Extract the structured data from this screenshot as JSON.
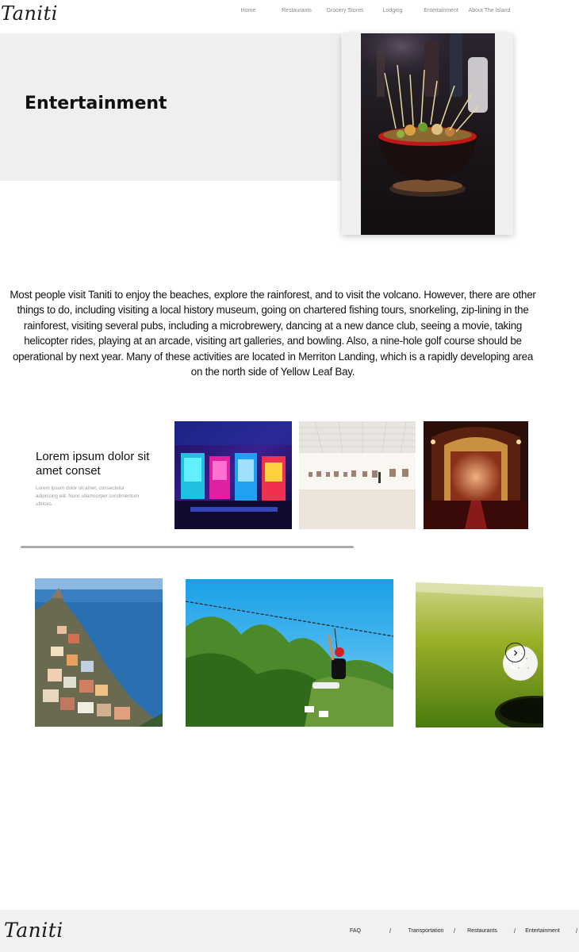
{
  "header": {
    "logo": "Taniti",
    "nav": [
      "Home",
      "Restaurants",
      "Grocery Stores",
      "Lodging",
      "Entertainment",
      "About The Island"
    ]
  },
  "hero": {
    "title": "Entertainment",
    "photo_icon": "food-bowl-skewers-photo"
  },
  "intro": {
    "text": "Most people visit Taniti to enjoy the beaches, explore the rainforest, and to visit the volcano. However, there are other things to do, including visiting a local history museum, going on chartered fishing tours, snorkeling, zip-lining in the rainforest, visiting several pubs, including a microbrewery, dancing at a new dance club, seeing a movie, taking helicopter rides, playing at an arcade, visiting art galleries, and bowling. Also, a nine-hole golf course should be operational by next year. Many of these activities are located in Merriton Landing, which is a rapidly developing area on the north side of Yellow Leaf Bay."
  },
  "feature": {
    "title": "Lorem ipsum dolor sit amet conset",
    "text": "Lorem ipsum dolor sit amet, consectetur adipiscing elit. Nunc ullamcorper condimentum ultrices.",
    "thumbnails": [
      "arcade-photo",
      "art-gallery-photo",
      "theater-photo"
    ]
  },
  "gallery": {
    "images": [
      "coastal-village-photo",
      "zip-line-photo",
      "golf-ball-photo"
    ],
    "next_icon": "chevron-right-icon"
  },
  "footer": {
    "logo": "Taniti",
    "links": [
      "FAQ",
      "Transportation",
      "Restaurants",
      "Entertainment"
    ],
    "separator": "/"
  }
}
